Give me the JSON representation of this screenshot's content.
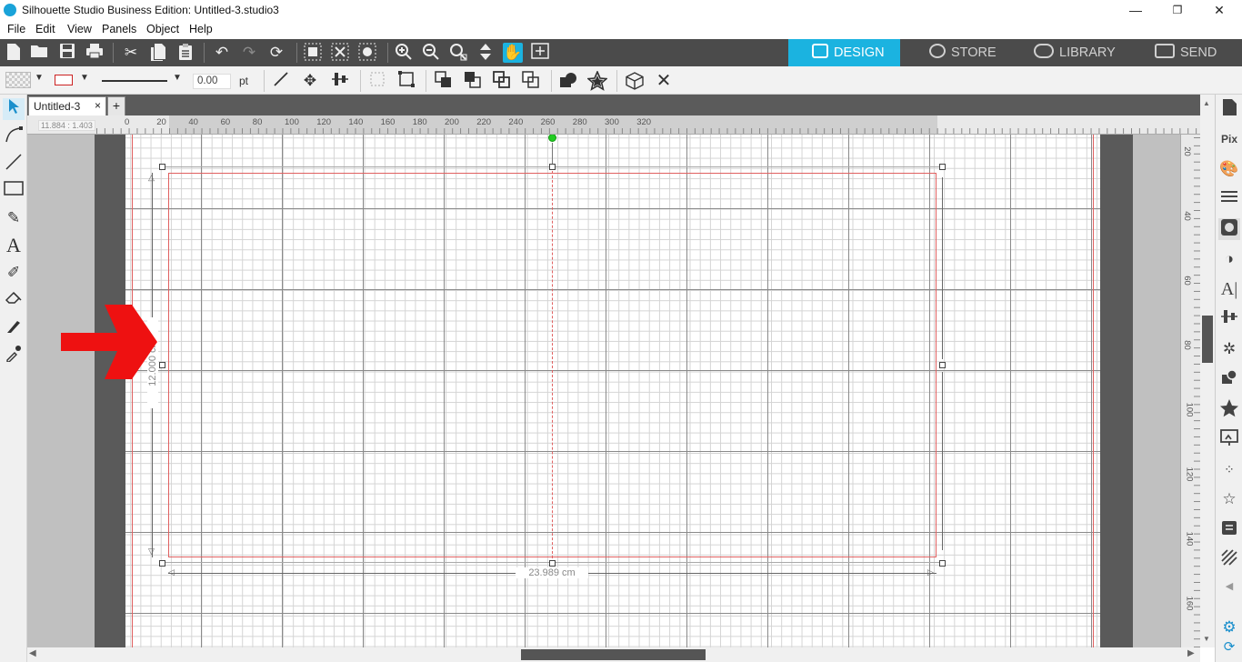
{
  "window": {
    "title": "Silhouette Studio Business Edition: Untitled-3.studio3",
    "minimize": "—",
    "maximize": "❐",
    "close": "✕"
  },
  "menu": [
    "File",
    "Edit",
    "View",
    "Panels",
    "Object",
    "Help"
  ],
  "nav_tabs": [
    {
      "label": "DESIGN",
      "active": true,
      "color": "#1bb3e0"
    },
    {
      "label": "STORE",
      "active": false
    },
    {
      "label": "LIBRARY",
      "active": false
    },
    {
      "label": "SEND",
      "active": false
    }
  ],
  "line_style": {
    "width_value": "0.00",
    "unit": "pt"
  },
  "document": {
    "tab_label": "Untitled-3",
    "tab_close": "×",
    "add_tab": "+"
  },
  "coordinate_readout": "11.884 : 1.403",
  "rulers": {
    "horizontal": [
      "0",
      "20",
      "40",
      "60",
      "80",
      "100",
      "120",
      "140",
      "160",
      "180",
      "200",
      "220",
      "240",
      "260",
      "280",
      "300",
      "320"
    ],
    "vertical": [
      "20",
      "40",
      "60",
      "80",
      "100",
      "120",
      "140",
      "160"
    ]
  },
  "selection": {
    "height_label": "12.000 cm",
    "width_label": "23.989 cm"
  },
  "colors": {
    "accent": "#1bb3e0",
    "guide_red": "#e06060",
    "arrow_red": "#ee1111",
    "handle_green": "#22cc22"
  }
}
